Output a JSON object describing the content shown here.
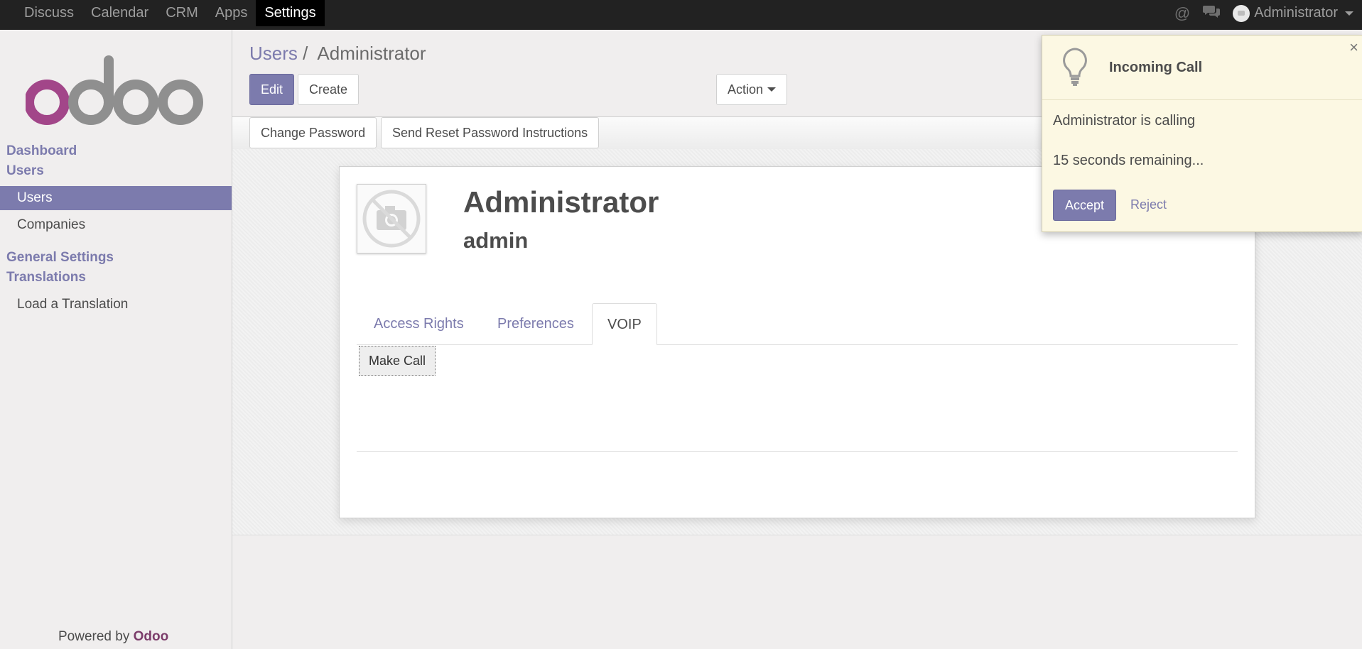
{
  "topbar": {
    "menu": [
      "Discuss",
      "Calendar",
      "CRM",
      "Apps",
      "Settings"
    ],
    "active_menu": "Settings",
    "user_name": "Administrator",
    "at_icon": "@"
  },
  "sidebar": {
    "logo_text": "odoo",
    "sections": {
      "dashboard": "Dashboard",
      "users": "Users",
      "general_settings": "General Settings",
      "translations": "Translations"
    },
    "items": {
      "users": "Users",
      "companies": "Companies",
      "load_translation": "Load a Translation"
    },
    "powered_prefix": "Powered by ",
    "powered_brand": "Odoo"
  },
  "breadcrumb": {
    "parent": "Users",
    "separator": "/",
    "current": "Administrator"
  },
  "buttons": {
    "edit": "Edit",
    "create": "Create",
    "action": "Action",
    "change_password": "Change Password",
    "send_reset": "Send Reset Password Instructions",
    "make_call": "Make Call"
  },
  "form": {
    "name": "Administrator",
    "login": "admin",
    "tabs": [
      "Access Rights",
      "Preferences",
      "VOIP"
    ],
    "active_tab": "VOIP"
  },
  "popup": {
    "title": "Incoming Call",
    "message": "Administrator is calling",
    "countdown": "15 seconds remaining...",
    "accept": "Accept",
    "reject": "Reject",
    "close": "×"
  },
  "colors": {
    "brand": "#7c7bad",
    "topbar": "#222222",
    "logo_o": "#a24689",
    "logo_grey": "#8f8f8f"
  }
}
